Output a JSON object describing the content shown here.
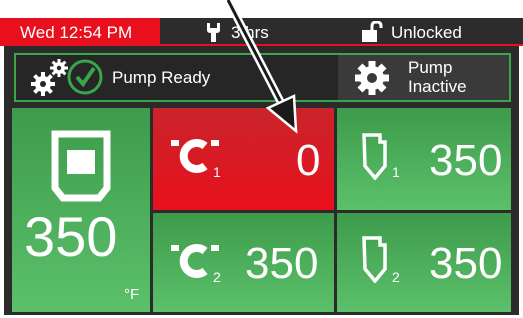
{
  "topbar": {
    "datetime": "Wed 12:54 PM",
    "hours": "3 hrs",
    "lock_status": "Unlocked",
    "accent_color": "#e8101c"
  },
  "status": {
    "pump_ready": "Pump Ready",
    "pump_inactive_line1": "Pump",
    "pump_inactive_line2": "Inactive"
  },
  "tank": {
    "temp": "350",
    "unit": "°F",
    "icon": "tank-icon"
  },
  "hose1": {
    "value": "0",
    "index": "1",
    "icon": "hose-icon",
    "state_color": "#e8101c"
  },
  "gun1": {
    "value": "350",
    "index": "1",
    "icon": "gun-icon"
  },
  "hose2": {
    "value": "350",
    "index": "2",
    "icon": "hose-icon"
  },
  "gun2": {
    "value": "350",
    "index": "2",
    "icon": "gun-icon"
  }
}
